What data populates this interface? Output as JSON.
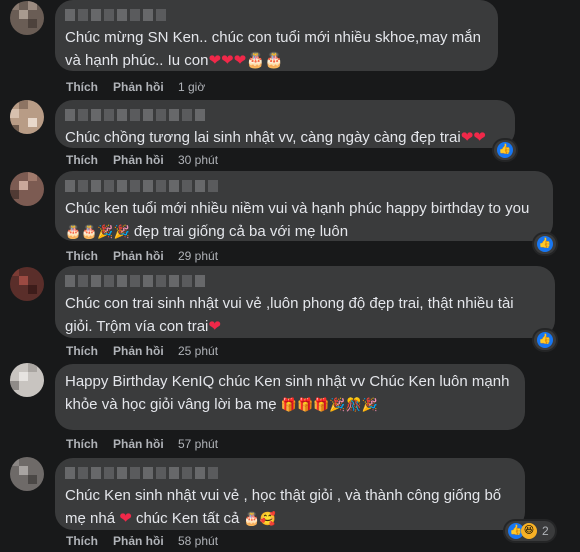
{
  "actions": {
    "like": "Thích",
    "reply": "Phản hồi"
  },
  "comments": [
    {
      "text": "Chúc mừng SN Ken.. chúc con tuổi mới nhiều skhoe,may mắn và hạnh phúc.. Iu con",
      "time": "1 giờ",
      "emoji": "❤❤❤🎂🎂"
    },
    {
      "text": "Chúc chồng tương lai sinh nhật vv, càng ngày càng đẹp trai",
      "time": "30 phút",
      "emoji": "❤❤"
    },
    {
      "text": "Chúc ken tuổi mới nhiều niềm vui và hạnh phúc happy birthday to you",
      "text2": "đẹp trai giống cả ba với mẹ luôn",
      "time": "29 phút",
      "emoji": "🎂🎂🎉🎉"
    },
    {
      "text": "Chúc con trai sinh nhật vui vẻ ,luôn phong độ đẹp trai, thật nhiều tài giỏi. Trộm vía con trai",
      "time": "25 phút",
      "emoji": "❤"
    },
    {
      "text": "Happy Birthday KenIQ chúc Ken sinh nhật vv Chúc Ken luôn mạnh khỏe và học giỏi vâng lời ba mẹ",
      "time": "57 phút",
      "emoji": "🎁🎁🎁🎉🎊🎉"
    },
    {
      "text": "Chúc Ken sinh nhật vui vẻ , học thật giỏi , và thành công giống bố mẹ nhá",
      "text2": "chúc Ken tất cả",
      "time": "58 phút",
      "emoji": "❤",
      "emoji2": "🎂🥰",
      "reaction_count": "2"
    }
  ],
  "colors": {
    "background": "#18191a",
    "bubble": "#3a3b3c",
    "text": "#e4e6eb",
    "meta": "#b0b3b8",
    "like_blue": "#1877f2",
    "heart": "#f02849"
  }
}
